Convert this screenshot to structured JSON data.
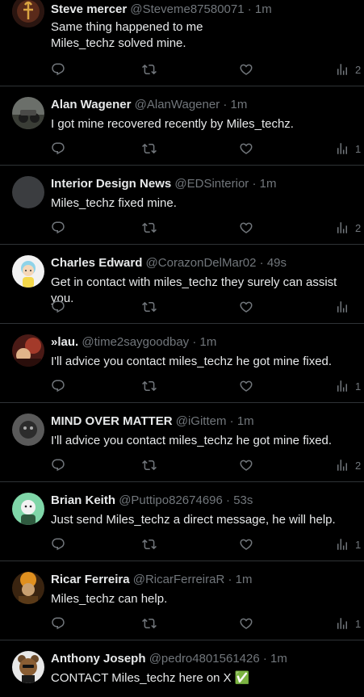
{
  "tweets": [
    {
      "name": "Steve mercer",
      "handle": "@Steveme87580071",
      "time": "1m",
      "lines": [
        "Same thing happened to me",
        "Miles_techz solved mine."
      ],
      "views": "2"
    },
    {
      "name": "Alan Wagener",
      "handle": "@AlanWagener",
      "time": "1m",
      "lines": [
        "I got mine recovered recently by Miles_techz."
      ],
      "views": "1"
    },
    {
      "name": "Interior Design News",
      "handle": "@EDSinterior",
      "time": "1m",
      "lines": [
        "Miles_techz fixed mine."
      ],
      "views": "2"
    },
    {
      "name": "Charles Edward",
      "handle": "@CorazonDelMar02",
      "time": "49s",
      "lines": [
        "Get in contact with miles_techz they surely can assist you."
      ],
      "views": ""
    },
    {
      "name": "»lau.",
      "handle": "@time2saygoodbay",
      "time": "1m",
      "lines": [
        "I'll advice you contact miles_techz he got mine fixed."
      ],
      "views": "1"
    },
    {
      "name": "MIND OVER MATTER",
      "handle": "@iGittem",
      "time": "1m",
      "lines": [
        "I'll advice you contact miles_techz he got mine fixed."
      ],
      "views": "2"
    },
    {
      "name": "Brian Keith",
      "handle": "@Puttipo82674696",
      "time": "53s",
      "lines": [
        "Just send Miles_techz a direct message, he will help."
      ],
      "views": "1"
    },
    {
      "name": "Ricar Ferreira",
      "handle": "@RicarFerreiraR",
      "time": "1m",
      "lines": [
        "Miles_techz can help."
      ],
      "views": "1"
    },
    {
      "name": "Anthony Joseph",
      "handle": "@pedro4801561426",
      "time": "1m",
      "lines": [
        "CONTACT Miles_techz here on X ✅"
      ],
      "views": ""
    }
  ],
  "separator": "·",
  "icons": {
    "reply": "reply-icon",
    "retweet": "retweet-icon",
    "like": "like-icon",
    "views": "views-icon"
  },
  "colors": {
    "background": "#000000",
    "text": "#e7e9ea",
    "muted": "#71767b",
    "divider": "#2f3336"
  }
}
